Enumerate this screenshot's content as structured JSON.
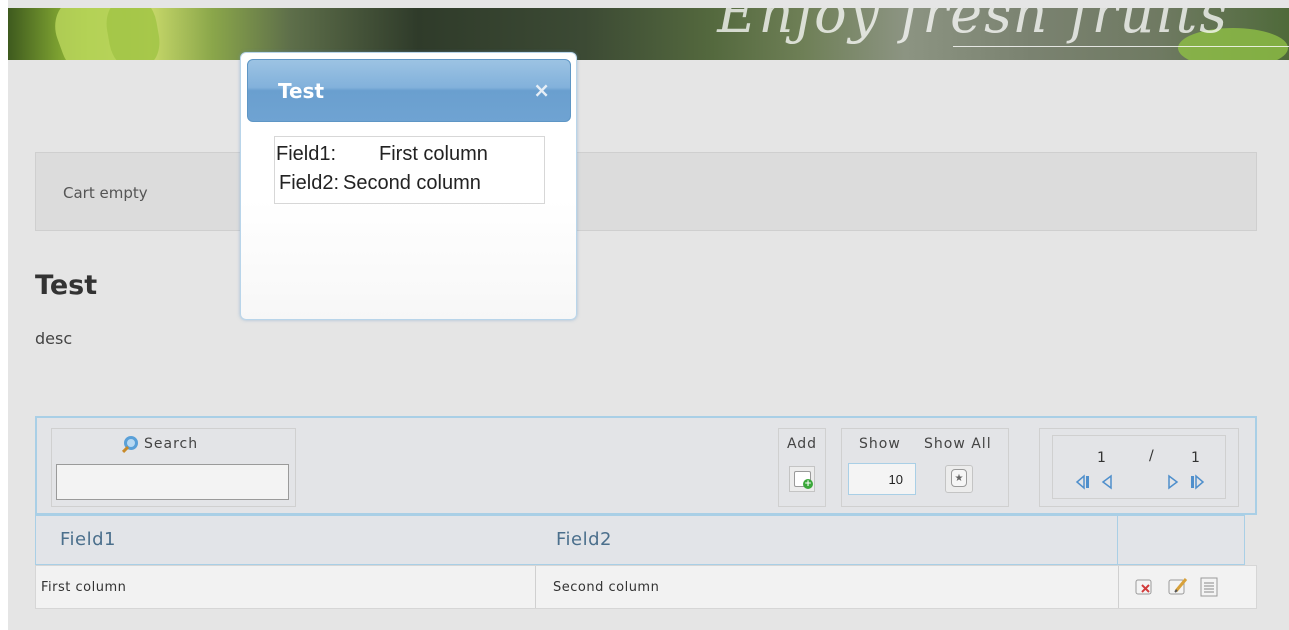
{
  "banner": {
    "title": "Enjoy fresh fruits"
  },
  "cart": {
    "status": "Cart empty"
  },
  "page": {
    "title": "Test",
    "description": "desc"
  },
  "toolbar": {
    "search_label": "Search",
    "search_value": "",
    "add_label": "Add",
    "show_label": "Show",
    "show_value": "10",
    "show_all_label": "Show All",
    "pager": {
      "current": "1",
      "separator": "/",
      "total": "1"
    }
  },
  "table": {
    "headers": [
      "Field1",
      "Field2"
    ],
    "rows": [
      {
        "field1": "First column",
        "field2": "Second column"
      }
    ]
  },
  "dialog": {
    "title": "Test",
    "close": "×",
    "fields": [
      {
        "label": "Field1:",
        "value": "First column"
      },
      {
        "label": "Field2:",
        "value": "Second column"
      }
    ]
  },
  "icons": {
    "search": "magnifier-icon",
    "add": "add-document-icon",
    "show_all": "show-all-icon",
    "first": "first-page-icon",
    "prev": "previous-page-icon",
    "next": "next-page-icon",
    "last": "last-page-icon",
    "delete": "delete-icon",
    "edit": "edit-icon",
    "view": "view-icon"
  },
  "colors": {
    "accent": "#6a9fcf",
    "header_text": "#4b6f8c",
    "border": "#a9cfe6"
  }
}
